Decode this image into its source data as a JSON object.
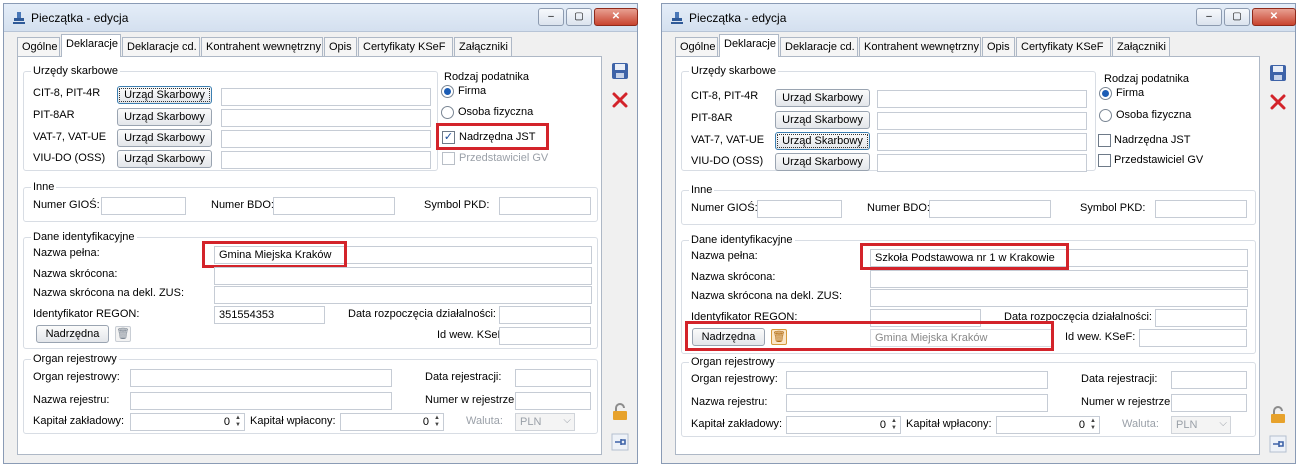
{
  "left": {
    "title": "Pieczątka - edycja",
    "tabs": [
      "Ogólne",
      "Deklaracje",
      "Deklaracje cd.",
      "Kontrahent wewnętrzny",
      "Opis",
      "Certyfikaty KSeF",
      "Załączniki"
    ],
    "urzedy": {
      "title": "Urzędy skarbowe",
      "rows": [
        {
          "label": "CIT-8, PIT-4R",
          "button": "Urząd Skarbowy"
        },
        {
          "label": "PIT-8AR",
          "button": "Urząd Skarbowy"
        },
        {
          "label": "VAT-7, VAT-UE",
          "button": "Urząd Skarbowy"
        },
        {
          "label": "VIU-DO (OSS)",
          "button": "Urząd Skarbowy"
        }
      ]
    },
    "rodzaj": {
      "title": "Rodzaj podatnika",
      "firma": "Firma",
      "osoba": "Osoba fizyczna",
      "nadrzedna": "Nadrzędna JST",
      "przedstawiciel": "Przedstawiciel GV"
    },
    "inne": {
      "title": "Inne",
      "gios": "Numer GIOŚ:",
      "bdo": "Numer BDO:",
      "pkd": "Symbol PKD:"
    },
    "dane": {
      "title": "Dane identyfikacyjne",
      "pelna_label": "Nazwa pełna:",
      "pelna_value": "Gmina Miejska Kraków",
      "skrocona_label": "Nazwa skrócona:",
      "zus_label": "Nazwa skrócona na dekl. ZUS:",
      "regon_label": "Identyfikator REGON:",
      "regon_value": "351554353",
      "data_rozp_label": "Data rozpoczęcia działalności:",
      "nadrzedna_btn": "Nadrzędna",
      "ksef_label": "Id wew. KSeF:"
    },
    "organ": {
      "title": "Organ rejestrowy",
      "organ_label": "Organ rejestrowy:",
      "data_rej_label": "Data rejestracji:",
      "nazwa_rej_label": "Nazwa rejestru:",
      "numer_rej_label": "Numer w rejestrze",
      "kapital_zakl_label": "Kapitał zakładowy:",
      "kapital_zakl_value": "0",
      "kapital_wpl_label": "Kapitał wpłacony:",
      "kapital_wpl_value": "0",
      "waluta_label": "Waluta:",
      "waluta_value": "PLN"
    }
  },
  "right": {
    "title": "Pieczątka - edycja",
    "tabs": [
      "Ogólne",
      "Deklaracje",
      "Deklaracje cd.",
      "Kontrahent wewnętrzny",
      "Opis",
      "Certyfikaty KSeF",
      "Załączniki"
    ],
    "urzedy": {
      "title": "Urzędy skarbowe",
      "rows": [
        {
          "label": "CIT-8, PIT-4R",
          "button": "Urząd Skarbowy"
        },
        {
          "label": "PIT-8AR",
          "button": "Urząd Skarbowy"
        },
        {
          "label": "VAT-7, VAT-UE",
          "button": "Urząd Skarbowy"
        },
        {
          "label": "VIU-DO (OSS)",
          "button": "Urząd Skarbowy"
        }
      ]
    },
    "rodzaj": {
      "title": "Rodzaj podatnika",
      "firma": "Firma",
      "osoba": "Osoba fizyczna",
      "nadrzedna": "Nadrzędna JST",
      "przedstawiciel": "Przedstawiciel GV"
    },
    "inne": {
      "title": "Inne",
      "gios": "Numer GIOŚ:",
      "bdo": "Numer BDO:",
      "pkd": "Symbol PKD:"
    },
    "dane": {
      "title": "Dane identyfikacyjne",
      "pelna_label": "Nazwa pełna:",
      "pelna_value": "Szkoła Podstawowa nr 1 w Krakowie",
      "skrocona_label": "Nazwa skrócona:",
      "zus_label": "Nazwa skrócona na dekl. ZUS:",
      "regon_label": "Identyfikator REGON:",
      "regon_value": "",
      "data_rozp_label": "Data rozpoczęcia działalności:",
      "nadrzedna_btn": "Nadrzędna",
      "nadrzedna_value": "Gmina Miejska Kraków",
      "ksef_label": "Id wew. KSeF:"
    },
    "organ": {
      "title": "Organ rejestrowy",
      "organ_label": "Organ rejestrowy:",
      "data_rej_label": "Data rejestracji:",
      "nazwa_rej_label": "Nazwa rejestru:",
      "numer_rej_label": "Numer w rejestrze",
      "kapital_zakl_label": "Kapitał zakładowy:",
      "kapital_zakl_value": "0",
      "kapital_wpl_label": "Kapitał wpłacony:",
      "kapital_wpl_value": "0",
      "waluta_label": "Waluta:",
      "waluta_value": "PLN"
    }
  }
}
